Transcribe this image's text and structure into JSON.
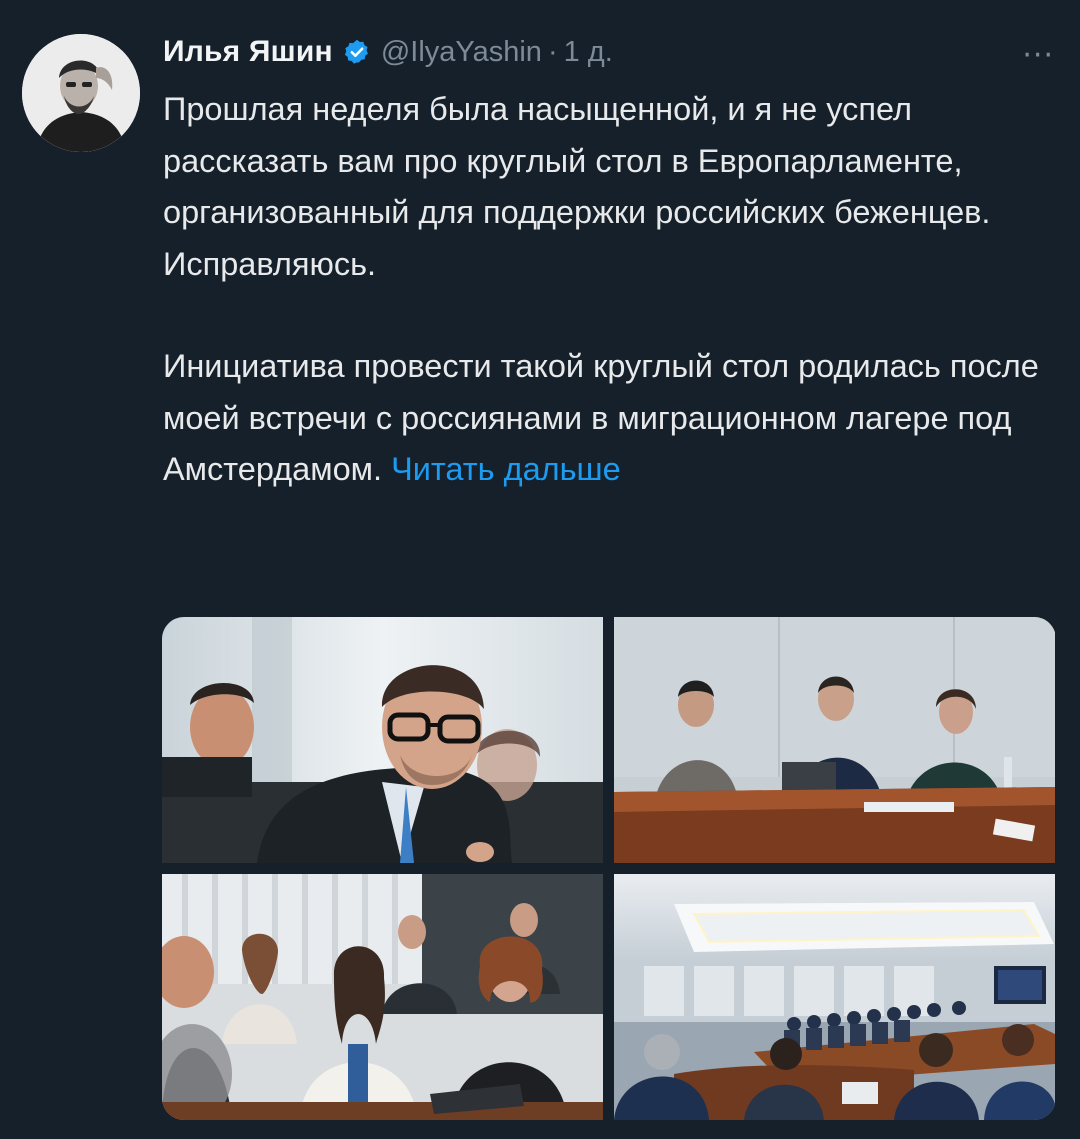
{
  "author": {
    "display_name": "Илья Яшин",
    "handle": "@IlyaYashin",
    "separator": "·",
    "time": "1 д.",
    "verified": true,
    "avatar": "avatar-photo"
  },
  "tweet": {
    "paragraphs": [
      "Прошлая неделя была насыщенной, и я не успел рассказать вам про круглый стол в Европарламенте, организованный для поддержки российских беженцев. Исправляюсь."
    ],
    "paragraph2_text": "Инициатива провести такой круглый стол родилась после моей встречи с россиянами в миграционном лагере под Амстердамом.",
    "read_more": "Читать дальше"
  },
  "menu": {
    "more_icon": "more-icon",
    "more_glyph": "···"
  },
  "media": {
    "count": 4,
    "photos": [
      {
        "name": "photo-speaker-closeup"
      },
      {
        "name": "photo-panel-three-people"
      },
      {
        "name": "photo-audience-women"
      },
      {
        "name": "photo-conference-room"
      }
    ]
  },
  "colors": {
    "background": "#16202b",
    "text": "#e7e9ea",
    "secondary": "#7d8a97",
    "link": "#1d9bf0",
    "verified": "#1d9bf0"
  }
}
